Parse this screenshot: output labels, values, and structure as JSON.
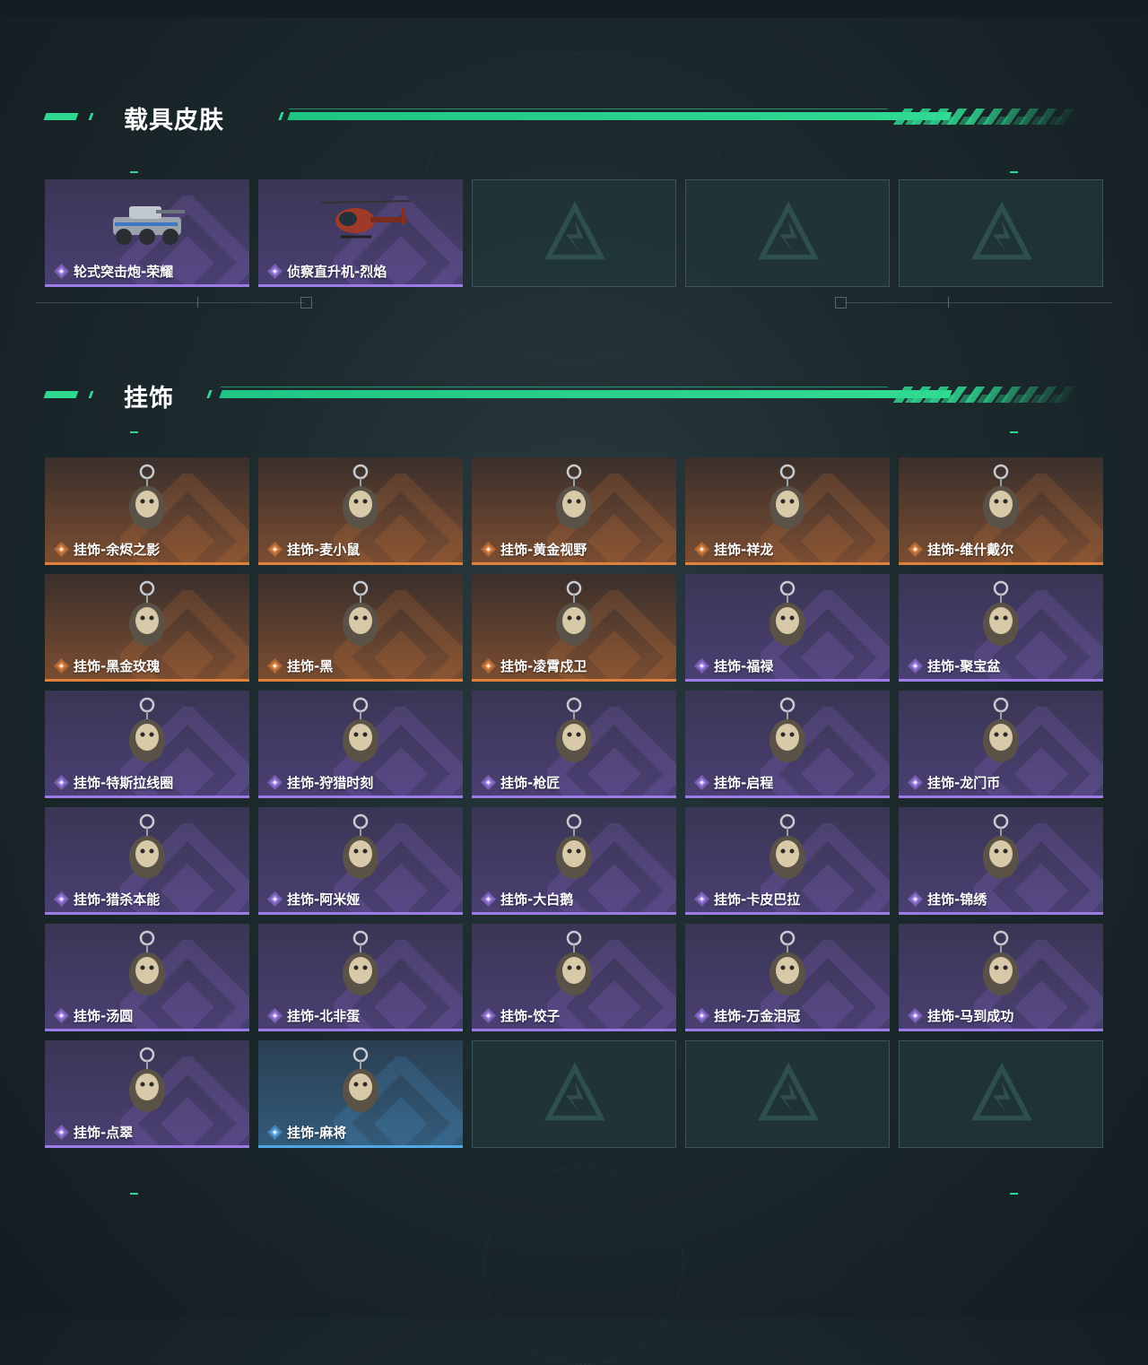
{
  "sections": [
    {
      "title": "载具皮肤",
      "items": [
        {
          "name": "轮式突击炮-荣耀",
          "rarity": "purple",
          "icon": "armored-vehicle-icon"
        },
        {
          "name": "侦察直升机-烈焰",
          "rarity": "purple",
          "icon": "helicopter-icon"
        },
        {
          "empty": true
        },
        {
          "empty": true
        },
        {
          "empty": true
        }
      ]
    },
    {
      "title": "挂饰",
      "items": [
        {
          "name": "挂饰-余烬之影",
          "rarity": "orange",
          "icon": "shadow-figure-charm-icon"
        },
        {
          "name": "挂饰-麦小鼠",
          "rarity": "orange",
          "icon": "mouse-charm-icon"
        },
        {
          "name": "挂饰-黄金视野",
          "rarity": "orange",
          "icon": "golden-vision-charm-icon"
        },
        {
          "name": "挂饰-祥龙",
          "rarity": "orange",
          "icon": "dragon-charm-icon"
        },
        {
          "name": "挂饰-维什戴尔",
          "rarity": "orange",
          "icon": "tag-charm-icon"
        },
        {
          "name": "挂饰-黑金玫瑰",
          "rarity": "orange",
          "icon": "black-rose-charm-icon"
        },
        {
          "name": "挂饰-黑",
          "rarity": "orange",
          "icon": "tag-charm-icon"
        },
        {
          "name": "挂饰-凌霄戍卫",
          "rarity": "orange",
          "icon": "penguin-charm-icon"
        },
        {
          "name": "挂饰-福禄",
          "rarity": "purple",
          "icon": "gourd-charm-icon"
        },
        {
          "name": "挂饰-聚宝盆",
          "rarity": "purple",
          "icon": "treasure-bowl-charm-icon"
        },
        {
          "name": "挂饰-特斯拉线圈",
          "rarity": "purple",
          "icon": "tesla-coil-charm-icon"
        },
        {
          "name": "挂饰-狩猎时刻",
          "rarity": "purple",
          "icon": "antler-charm-icon"
        },
        {
          "name": "挂饰-枪匠",
          "rarity": "purple",
          "icon": "gunsmith-charm-icon"
        },
        {
          "name": "挂饰-启程",
          "rarity": "purple",
          "icon": "emblem-charm-icon"
        },
        {
          "name": "挂饰-龙门币",
          "rarity": "purple",
          "icon": "coin-card-charm-icon"
        },
        {
          "name": "挂饰-猎杀本能",
          "rarity": "purple",
          "icon": "antler-charm-icon"
        },
        {
          "name": "挂饰-阿米娅",
          "rarity": "purple",
          "icon": "bunny-charm-icon"
        },
        {
          "name": "挂饰-大白鹅",
          "rarity": "purple",
          "icon": "goose-charm-icon"
        },
        {
          "name": "挂饰-卡皮巴拉",
          "rarity": "purple",
          "icon": "capybara-charm-icon"
        },
        {
          "name": "挂饰-锦绣",
          "rarity": "purple",
          "icon": "butterfly-charm-icon"
        },
        {
          "name": "挂饰-汤圆",
          "rarity": "purple",
          "icon": "dumpling-bowl-charm-icon"
        },
        {
          "name": "挂饰-北非蛋",
          "rarity": "purple",
          "icon": "shakshuka-charm-icon"
        },
        {
          "name": "挂饰-饺子",
          "rarity": "purple",
          "icon": "dumpling-plate-charm-icon"
        },
        {
          "name": "挂饰-万金泪冠",
          "rarity": "purple",
          "icon": "crown-charm-icon"
        },
        {
          "name": "挂饰-马到成功",
          "rarity": "purple",
          "icon": "horse-charm-icon"
        },
        {
          "name": "挂饰-点翠",
          "rarity": "purple",
          "icon": "jade-dragon-charm-icon"
        },
        {
          "name": "挂饰-麻将",
          "rarity": "blue",
          "icon": "mahjong-tile-charm-icon"
        },
        {
          "empty": true
        },
        {
          "empty": true
        },
        {
          "empty": true
        }
      ]
    }
  ],
  "colors": {
    "accent": "#2fd890",
    "purple": "#9d7be6",
    "orange": "#e0823e",
    "blue": "#54a8e8"
  }
}
